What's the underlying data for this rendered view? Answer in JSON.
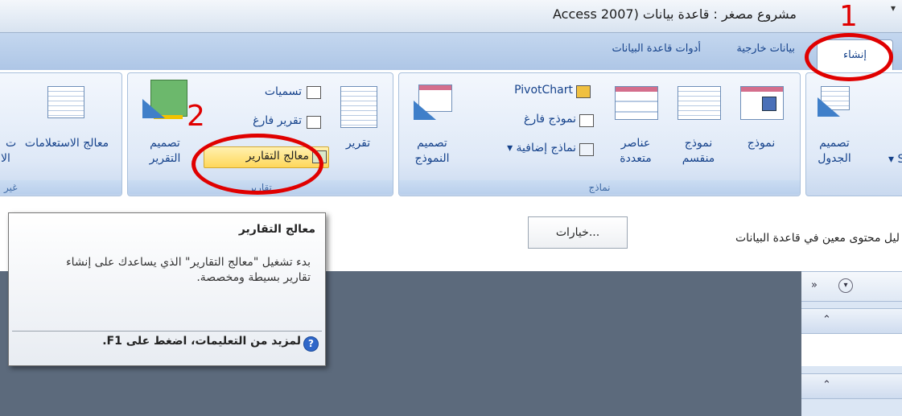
{
  "window": {
    "title": "مشروع مصغر : قاعدة بيانات (Access 2007",
    "quick_access_arrow": "▾"
  },
  "tabs": {
    "create": "إنشاء",
    "external_data": "بيانات خارجية",
    "db_tools": "أدوات قاعدة البيانات"
  },
  "ribbon": {
    "tables": {
      "table_design": "تصميم الجدول",
      "s_label": "S ▾"
    },
    "forms": {
      "group_label": "نماذج",
      "form": "نموذج",
      "split_form": "نموذج منقسم",
      "multiple_items": "عناصر متعددة",
      "pivotchart": "PivotChart",
      "blank_form": "نموذج فارغ",
      "more_forms": "نماذج إضافية ▾",
      "form_design": "تصميم النموذج"
    },
    "reports": {
      "group_label": "تقارير",
      "report": "تقرير",
      "labels": "تسميات",
      "blank_report": "تقرير فارغ",
      "report_wizard": "معالج التقارير",
      "report_design": "تصميم التقرير"
    },
    "other": {
      "query_wizard": "معالج الاستعلامات",
      "partial_left": "ت",
      "partial_left2": "الا",
      "group_label": "غير"
    }
  },
  "message_bar": {
    "options_button": "خيارات...",
    "message": "ليل محتوى معين في قاعدة البيانات"
  },
  "nav_pane": {
    "chevron": "»",
    "dropdown": "▾",
    "collapse": "⌃"
  },
  "tooltip": {
    "title": "معالج التقارير",
    "body": "بدء تشغيل \"معالج التقارير\" الذي يساعدك على إنشاء تقارير بسيطة ومخصصة.",
    "help": "لمزيد من التعليمات، اضغط على F1.",
    "help_icon": "?"
  },
  "annotations": {
    "one": "1",
    "two": "2"
  },
  "colors": {
    "annotation": "#e00000",
    "ribbon_text": "#15428b"
  }
}
